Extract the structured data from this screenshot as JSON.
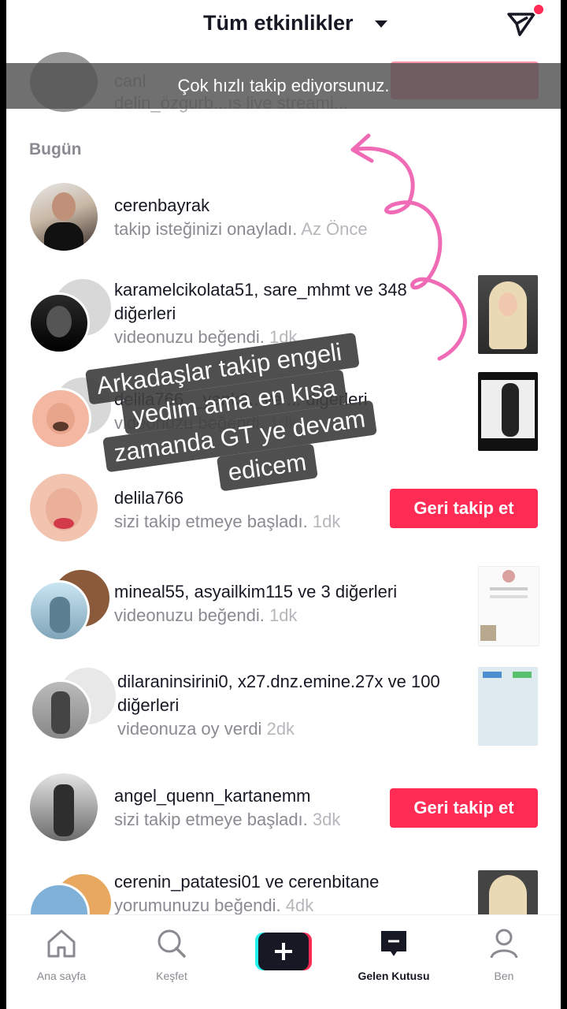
{
  "header": {
    "title": "Tüm etkinlikler"
  },
  "toast": "Çok hızlı takip ediyorsunuz.",
  "ghost_row": {
    "line1": "canl",
    "line2": "delin_özgurb...ıs live streami..."
  },
  "section_today": "Bugün",
  "notifications": [
    {
      "users": "cerenbayrak",
      "action": "takip isteğinizi onayladı.",
      "time": "Az Önce"
    },
    {
      "users": "karamelcikolata51, sare_mhmt ve 348 diğerleri",
      "action": "videonuzu beğendi.",
      "time": "1dk"
    },
    {
      "users": "delila766, _yank0...ve ... diğerleri",
      "action": "videonuzu beğendi.",
      "time": "1dk"
    },
    {
      "users": "delila766",
      "action": "sizi takip etmeye başladı.",
      "time": "1dk",
      "button": "Geri takip et"
    },
    {
      "users": "mineal55, asyailkim115 ve 3 diğerleri",
      "action": "videonuzu beğendi.",
      "time": "1dk"
    },
    {
      "users": "dilaraninsirini0, x27.dnz.emine.27x ve 100 diğerleri",
      "action": "videonuza oy verdi",
      "time": "2dk"
    },
    {
      "users": "angel_quenn_kartanemm",
      "action": "sizi takip etmeye başladı.",
      "time": "3dk",
      "button": "Geri takip et"
    },
    {
      "users": "cerenin_patatesi01 ve cerenbitane",
      "action": "yorumunuzu beğendi.",
      "time": "4dk"
    }
  ],
  "overlay_lines": [
    "Arkadaşlar takip engeli",
    "yedim ama en kısa",
    "zamanda GT ye devam",
    "edicem"
  ],
  "nav": {
    "home": "Ana sayfa",
    "discover": "Keşfet",
    "inbox": "Gelen Kutusu",
    "me": "Ben"
  },
  "colors": {
    "accent": "#fe2c55",
    "annotation": "#f06bb5"
  }
}
